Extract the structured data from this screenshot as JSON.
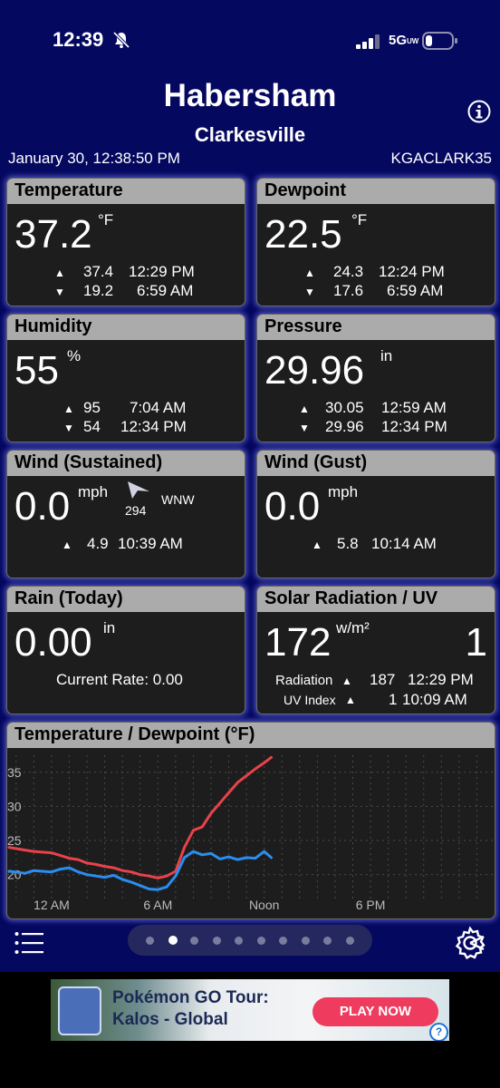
{
  "status_bar": {
    "time": "12:39",
    "network": "5G",
    "network_suffix": "UW"
  },
  "header": {
    "title": "Habersham",
    "subtitle": "Clarkesville",
    "datetime": "January 30, 12:38:50 PM",
    "station_id": "KGACLARK35"
  },
  "cards": {
    "temperature": {
      "title": "Temperature",
      "value": "37.2",
      "unit": "°F",
      "high": {
        "value": "37.4",
        "time": "12:29 PM"
      },
      "low": {
        "value": "19.2",
        "time": "6:59 AM"
      }
    },
    "dewpoint": {
      "title": "Dewpoint",
      "value": "22.5",
      "unit": "°F",
      "high": {
        "value": "24.3",
        "time": "12:24 PM"
      },
      "low": {
        "value": "17.6",
        "time": "6:59 AM"
      }
    },
    "humidity": {
      "title": "Humidity",
      "value": "55",
      "unit": "%",
      "high": {
        "value": "95",
        "time": "7:04 AM"
      },
      "low": {
        "value": "54",
        "time": "12:34 PM"
      }
    },
    "pressure": {
      "title": "Pressure",
      "value": "29.96",
      "unit": "in",
      "high": {
        "value": "30.05",
        "time": "12:59 AM"
      },
      "low": {
        "value": "29.96",
        "time": "12:34 PM"
      }
    },
    "wind": {
      "title": "Wind (Sustained)",
      "value": "0.0",
      "unit": "mph",
      "direction_deg": "294",
      "direction": "WNW",
      "high": {
        "value": "4.9",
        "time": "10:39 AM"
      }
    },
    "gust": {
      "title": "Wind (Gust)",
      "value": "0.0",
      "unit": "mph",
      "high": {
        "value": "5.8",
        "time": "10:14 AM"
      }
    },
    "rain": {
      "title": "Rain (Today)",
      "value": "0.00",
      "unit": "in",
      "rate_text": "Current Rate: 0.00"
    },
    "solar": {
      "title": "Solar Radiation / UV",
      "value": "172",
      "unit": "w/m²",
      "uv_value": "1",
      "radiation_label": "Radiation",
      "radiation_high": "187",
      "radiation_time": "12:29 PM",
      "uv_label": "UV Index",
      "uv_high": "1",
      "uv_time": "10:09 AM"
    }
  },
  "chart_title": "Temperature / Dewpoint (°F)",
  "chart_data": {
    "type": "line",
    "title": "Temperature / Dewpoint (°F)",
    "x_ticks": [
      "12 AM",
      "6 AM",
      "Noon",
      "6 PM"
    ],
    "x_tick_hours": [
      0,
      6,
      12,
      18
    ],
    "xlim": [
      -2.5,
      25
    ],
    "y_ticks": [
      "35",
      "30",
      "25",
      "20"
    ],
    "y_tick_values": [
      35,
      30,
      25,
      20
    ],
    "ylim": [
      16.5,
      37.5
    ],
    "colors": [
      "#e8424a",
      "#2a8ef0"
    ],
    "series": [
      {
        "x": [
          -2.4,
          -1.5,
          -1,
          0,
          0.5,
          1,
          1.5,
          2,
          2.5,
          3,
          3.5,
          4,
          4.5,
          5,
          5.5,
          6,
          6.5,
          7,
          7.5,
          8,
          8.5,
          9,
          9.5,
          10,
          10.5,
          11,
          11.5,
          12,
          12.4
        ],
        "values": [
          24,
          23.6,
          23.4,
          23.2,
          22.8,
          22.4,
          22.2,
          21.7,
          21.5,
          21.2,
          21.0,
          20.6,
          20.4,
          20.0,
          19.8,
          19.5,
          19.8,
          20.5,
          24,
          26.5,
          27,
          29,
          30.5,
          32,
          33.5,
          34.5,
          35.5,
          36.4,
          37.2
        ]
      },
      {
        "x": [
          -2.4,
          -1.5,
          -1,
          0,
          0.5,
          1,
          1.5,
          2,
          2.5,
          3,
          3.5,
          4,
          4.5,
          5,
          5.5,
          6,
          6.5,
          7,
          7.5,
          8,
          8.5,
          9,
          9.5,
          10,
          10.5,
          11,
          11.5,
          12,
          12.4
        ],
        "values": [
          20.5,
          20.2,
          20.6,
          20.4,
          20.8,
          21.0,
          20.4,
          20.0,
          19.8,
          19.6,
          19.9,
          19.3,
          18.9,
          18.4,
          17.9,
          17.8,
          18.2,
          19.8,
          22.5,
          23.4,
          22.9,
          23.1,
          22.3,
          22.6,
          22.2,
          22.5,
          22.4,
          23.4,
          22.5
        ]
      }
    ]
  },
  "ad": {
    "line1": "Pokémon GO Tour:",
    "line2": "Kalos - Global",
    "button": "PLAY NOW",
    "help": "?"
  },
  "pager": {
    "page_count": 10,
    "active_index": 1
  }
}
